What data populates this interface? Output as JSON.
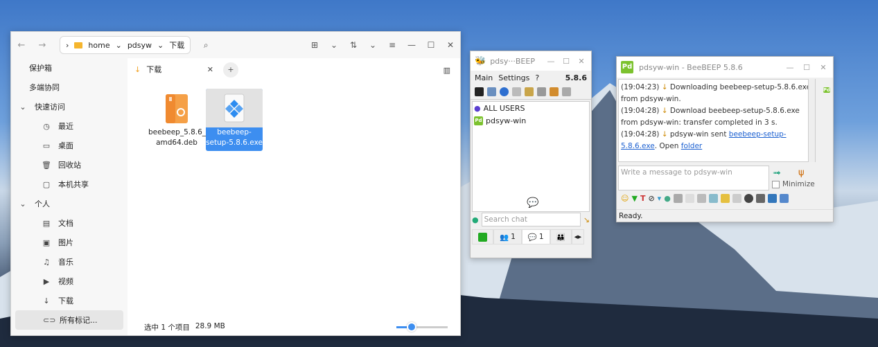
{
  "desktop": {
    "sky_color": "#4a82cc"
  },
  "file_manager": {
    "breadcrumb": [
      "home",
      "pdsyw",
      "下载"
    ],
    "sidebar": {
      "items": [
        {
          "label": "保护箱",
          "icon": "safe-icon",
          "level": "top"
        },
        {
          "label": "多端协同",
          "icon": "sync-icon",
          "level": "top"
        },
        {
          "label": "快速访问",
          "icon": "chevron-down-icon",
          "level": "header"
        },
        {
          "label": "最近",
          "icon": "clock-icon",
          "level": "sub"
        },
        {
          "label": "桌面",
          "icon": "desktop-icon",
          "level": "sub"
        },
        {
          "label": "回收站",
          "icon": "trash-icon",
          "level": "sub"
        },
        {
          "label": "本机共享",
          "icon": "folder-share-icon",
          "level": "sub"
        },
        {
          "label": "个人",
          "icon": "chevron-down-icon",
          "level": "header"
        },
        {
          "label": "文档",
          "icon": "document-icon",
          "level": "sub"
        },
        {
          "label": "图片",
          "icon": "image-icon",
          "level": "sub"
        },
        {
          "label": "音乐",
          "icon": "music-icon",
          "level": "sub"
        },
        {
          "label": "视频",
          "icon": "video-icon",
          "level": "sub"
        },
        {
          "label": "下载",
          "icon": "download-icon",
          "level": "sub"
        },
        {
          "label": "所有标记...",
          "icon": "tag-icon",
          "level": "selected"
        }
      ]
    },
    "tab_label": "下载",
    "files": [
      {
        "name": "beebeep_5.8.6_amd64.deb",
        "line1": "beebeep_5.8.6_",
        "line2": "amd64.deb",
        "selected": false
      },
      {
        "name": "beebeep-setup-5.8.6.exe",
        "line1": "beebeep-",
        "line2": "setup-5.8.6.exe",
        "selected": true
      }
    ],
    "status": {
      "selection": "选中 1 个项目",
      "size": "28.9 MB"
    },
    "zoom_fraction": 0.3
  },
  "beebeep_main": {
    "title": "pdsy···BEEP",
    "menu": {
      "main": "Main",
      "settings": "Settings",
      "help": "?",
      "version": "5.8.6"
    },
    "users": [
      {
        "label": "ALL USERS"
      },
      {
        "label": "pdsyw-win"
      }
    ],
    "search_placeholder": "Search chat",
    "tabs": [
      {
        "label": "1",
        "icon": "users-icon"
      },
      {
        "label": "1",
        "icon": "chat-icon"
      }
    ]
  },
  "beebeep_chat": {
    "title": "pdsyw-win - BeeBEEP 5.8.6",
    "log": [
      {
        "time": "(19:04:23)",
        "text": "Downloading beebeep-setup-5.8.6.exe from pdsyw-win."
      },
      {
        "time": "(19:04:28)",
        "text": "Download beebeep-setup-5.8.6.exe from pdsyw-win: transfer completed in 3 s."
      },
      {
        "time": "(19:04:28)",
        "text_before": "pdsyw-win sent ",
        "link": "beebeep-setup-5.8.6.exe",
        "text_after": ". Open ",
        "link2": "folder"
      }
    ],
    "input_placeholder": "Write a message to pdsyw-win",
    "minimize_label": "Minimize",
    "status": "Ready."
  }
}
